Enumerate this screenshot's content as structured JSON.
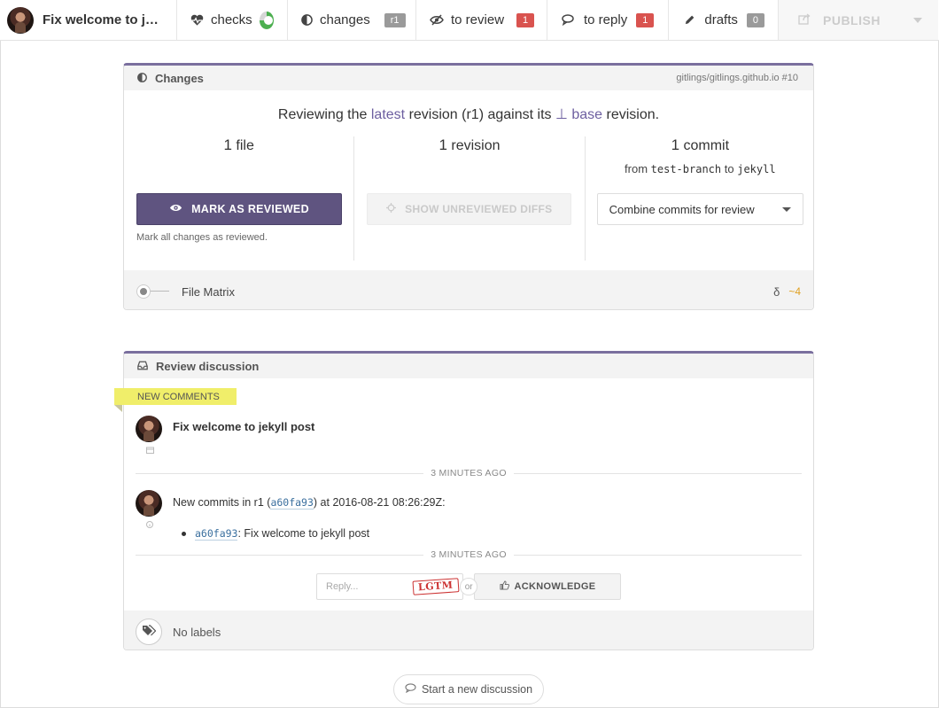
{
  "topbar": {
    "title": "Fix welcome to jek...",
    "checks_label": "checks",
    "changes_label": "changes",
    "changes_badge": "r1",
    "to_review_label": "to review",
    "to_review_badge": "1",
    "to_reply_label": "to reply",
    "to_reply_badge": "1",
    "drafts_label": "drafts",
    "drafts_badge": "0",
    "publish_label": "PUBLISH"
  },
  "changes_panel": {
    "header": "Changes",
    "repo_ref": "gitlings/gitlings.github.io #10",
    "reviewing_prefix": "Reviewing the",
    "latest": "latest",
    "reviewing_mid": "revision (r1) against its",
    "base_symbol": "⊥",
    "base": "base",
    "reviewing_suffix": "revision.",
    "files_count": "1",
    "files_label": "file",
    "revisions_count": "1",
    "revisions_label": "revision",
    "commits_count": "1",
    "commits_label": "commit",
    "from_word": "from",
    "from_branch": "test-branch",
    "to_word": "to",
    "to_branch": "jekyll",
    "mark_reviewed_label": "MARK AS REVIEWED",
    "mark_help": "Mark all changes as reviewed.",
    "show_unreviewed_label": "SHOW UNREVIEWED DIFFS",
    "combine_label": "Combine commits for review",
    "file_matrix_label": "File Matrix",
    "delta_symbol": "δ",
    "delta_value": "~4"
  },
  "discussion_panel": {
    "header": "Review discussion",
    "new_comments_tag": "NEW COMMENTS",
    "message1_title": "Fix welcome to jekyll post",
    "separator1": "3 MINUTES AGO",
    "message2_prefix": "New commits in r1 (",
    "message2_sha": "a60fa93",
    "message2_suffix": ") at 2016-08-21 08:26:29Z:",
    "commit_sha": "a60fa93",
    "commit_message": ": Fix welcome to jekyll post",
    "separator2": "3 MINUTES AGO",
    "reply_placeholder": "Reply...",
    "lgtm_label": "LGTM",
    "or_label": "or",
    "acknowledge_label": "ACKNOWLEDGE",
    "labels_text": "No labels"
  },
  "new_discussion_label": "Start a new discussion",
  "colors": {
    "accent": "#6d5fa0",
    "primary_button": "#5f5480",
    "badge_red": "#d9534f",
    "badge_gray": "#9a9a9a",
    "new_comments_highlight": "#f0ee6a",
    "checks_green": "#4caf50"
  },
  "icons": {
    "checks": "heartbeat-icon",
    "changes": "half-circle-icon",
    "to_review": "eye-slash-icon",
    "to_reply": "comments-icon",
    "drafts": "pencil-icon",
    "publish": "share-icon",
    "review_discussion": "inbox-icon",
    "labels": "tags-icon",
    "acknowledge": "thumbs-up-icon",
    "new_discussion": "comment-icon"
  }
}
